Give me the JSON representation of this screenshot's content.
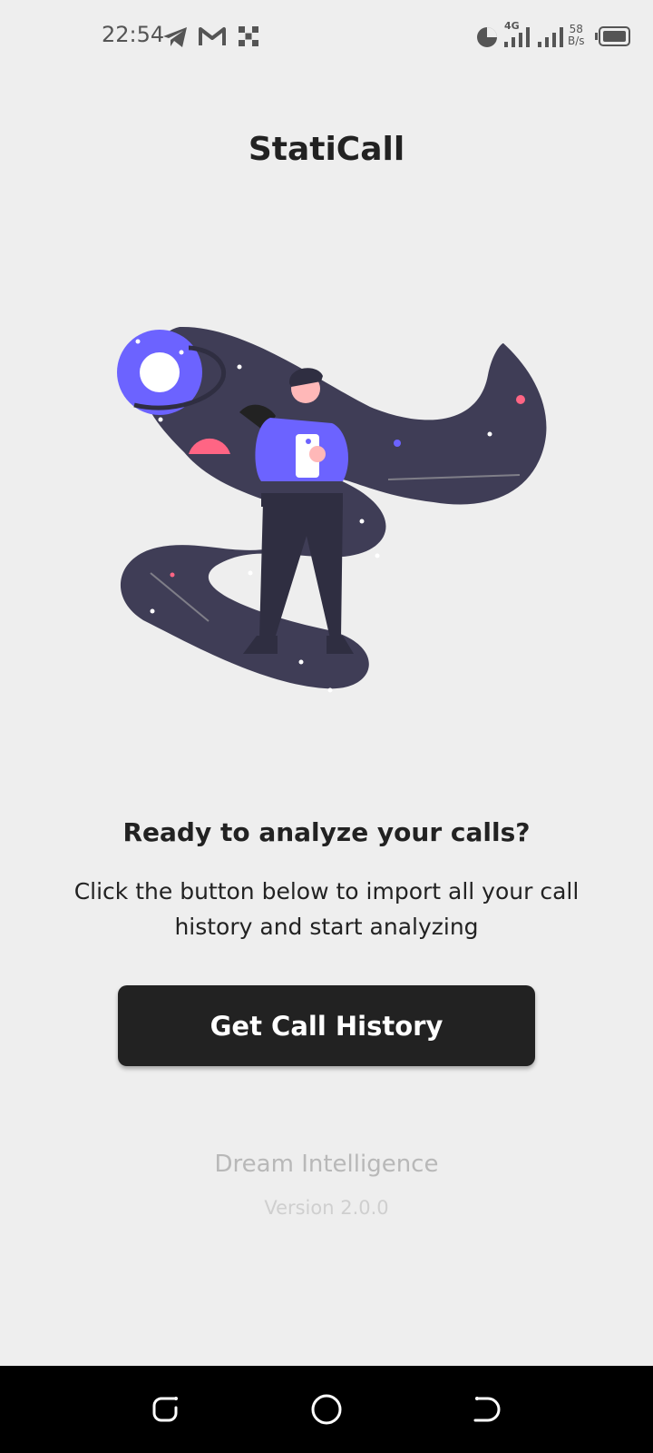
{
  "status_bar": {
    "time": "22:54",
    "network_type": "4G",
    "net_speed_value": "58",
    "net_speed_unit": "B/s",
    "icons": [
      "telegram-icon",
      "gmail-icon",
      "app-notification-icon",
      "data-usage-icon",
      "signal-icon",
      "signal-icon",
      "battery-icon"
    ]
  },
  "app": {
    "title": "StatiCall"
  },
  "main": {
    "heading": "Ready to analyze your calls?",
    "description": "Click the button below to import all your call history and start analyzing",
    "button_label": "Get Call History"
  },
  "footer": {
    "company": "Dream Intelligence",
    "version": "Version 2.0.0"
  },
  "nav_bar": {
    "buttons": [
      "recent-apps-icon",
      "home-icon",
      "back-icon"
    ]
  },
  "colors": {
    "background": "#eeeeee",
    "button_bg": "#222222",
    "button_text": "#ffffff",
    "accent_purple": "#6c63ff",
    "accent_pink": "#ff6584",
    "space_dark": "#3f3d56"
  }
}
